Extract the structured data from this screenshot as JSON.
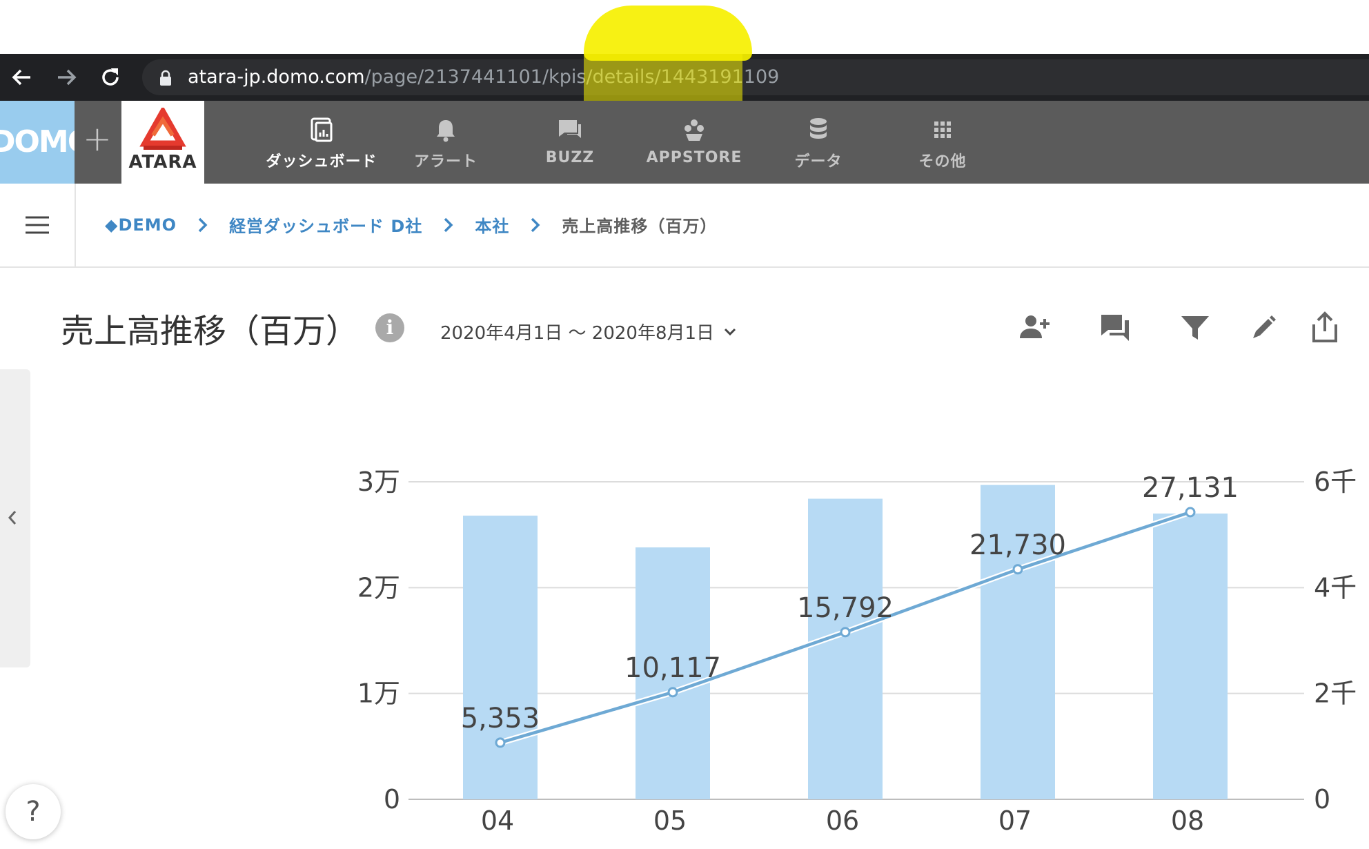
{
  "browser": {
    "url_host": "atara-jp.domo.com",
    "url_path": "/page/2137441101/kpis/details/1443191109"
  },
  "nav": {
    "domo_logo": "DOMO",
    "plus": "+",
    "atara_logo": "ATARA",
    "items": [
      {
        "label": "ダッシュボード",
        "icon": "dashboard-icon"
      },
      {
        "label": "アラート",
        "icon": "bell-icon"
      },
      {
        "label": "BUZZ",
        "icon": "chat-icon"
      },
      {
        "label": "APPSTORE",
        "icon": "appstore-icon"
      },
      {
        "label": "データ",
        "icon": "database-icon"
      },
      {
        "label": "その他",
        "icon": "grid-icon"
      }
    ]
  },
  "breadcrumb": [
    "◆DEMO",
    "経営ダッシュボード D社",
    "本社",
    "売上高推移（百万）"
  ],
  "page": {
    "title": "売上高推移（百万）",
    "info": "i",
    "date_range": "2020年4月1日 ～ 2020年8月1日",
    "help": "?"
  },
  "toolbar": [
    "add-user-icon",
    "comment-icon",
    "filter-icon",
    "pencil-icon",
    "share-icon"
  ],
  "colors": {
    "bar": "#b7daf4",
    "line": "#6ea9d4",
    "nav_bg": "#5b5b5b",
    "link": "#3f87c4",
    "highlight": "#f6f000"
  },
  "chart_data": {
    "type": "bar+line",
    "categories": [
      "04",
      "05",
      "06",
      "07",
      "08"
    ],
    "bar_values": [
      26800,
      23800,
      28400,
      29700,
      27000
    ],
    "line_values": [
      5353,
      10117,
      15792,
      21730,
      27131
    ],
    "line_labels": [
      "5,353",
      "10,117",
      "15,792",
      "21,730",
      "27,131"
    ],
    "y_left_ticks": [
      "0",
      "1万",
      "2万",
      "3万"
    ],
    "y_left_range": [
      0,
      30000
    ],
    "y_right_ticks": [
      "0",
      "2千",
      "4千",
      "6千"
    ],
    "y_right_range": [
      0,
      6000
    ],
    "grid": true
  }
}
